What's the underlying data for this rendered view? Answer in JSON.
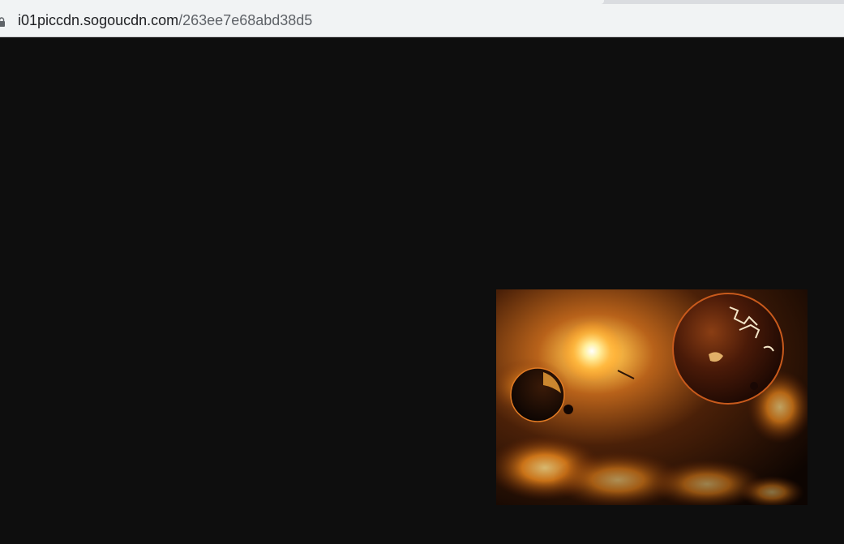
{
  "address_bar": {
    "icon": "lock-icon",
    "host": "i01piccdn.sogoucdn.com",
    "path": "/263ee7e68abd38d5"
  },
  "image": {
    "description": "space scene with burning planets and a bright star",
    "colors": {
      "background": "#0e0e0e",
      "fire": "#ffb040",
      "glow": "#fff2b0"
    }
  }
}
